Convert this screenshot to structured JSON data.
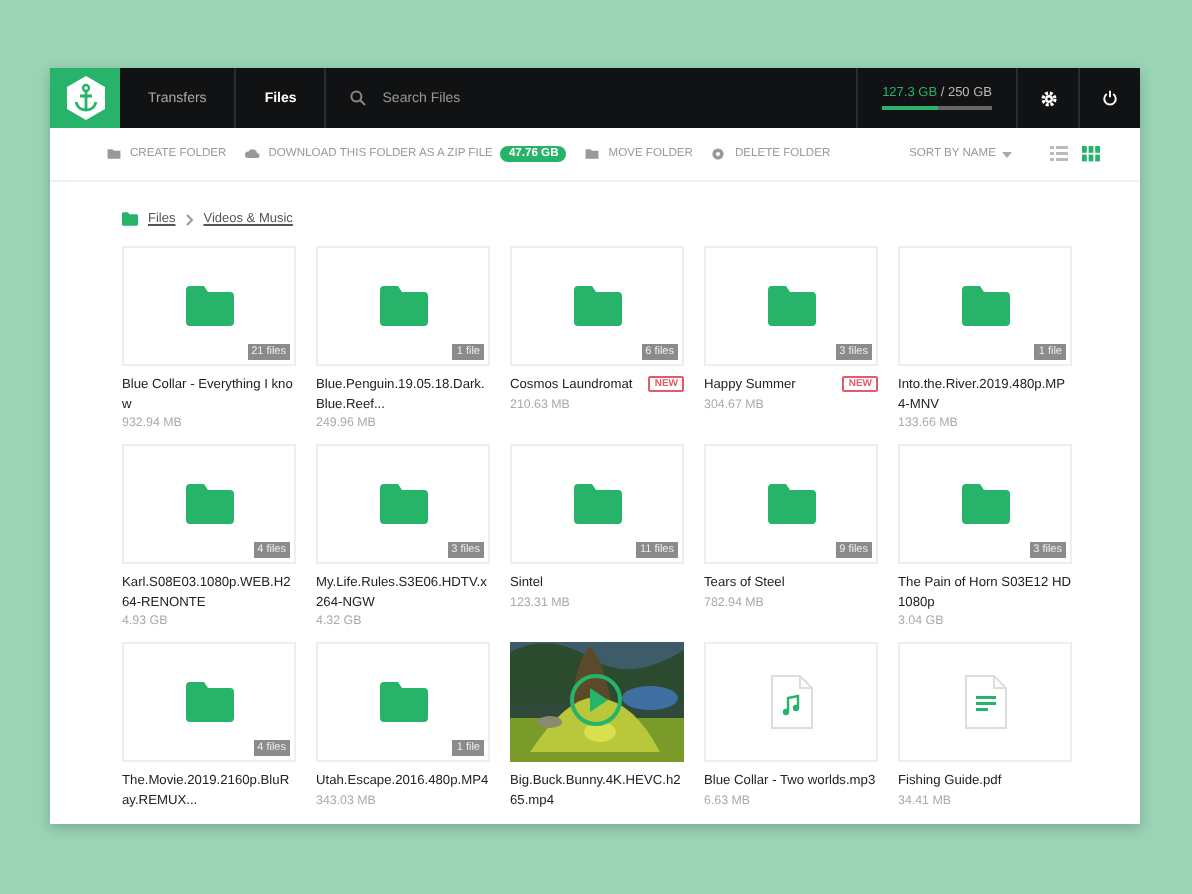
{
  "topbar": {
    "tabs": [
      {
        "label": "Transfers",
        "selected": false
      },
      {
        "label": "Files",
        "selected": true
      }
    ],
    "search": {
      "placeholder": "Search Files"
    },
    "storage": {
      "used": "127.3 GB",
      "total": " / 250 GB",
      "level": 0.51
    }
  },
  "toolbar": {
    "actions": [
      {
        "kind": "create",
        "label": "CREATE FOLDER"
      },
      {
        "kind": "download",
        "label": "DOWNLOAD THIS FOLDER AS A ZIP FILE",
        "badge": "47.76 GB"
      },
      {
        "kind": "move",
        "label": "MOVE FOLDER"
      },
      {
        "kind": "delete",
        "label": "DELETE FOLDER"
      }
    ],
    "sort": "SORT BY NAME",
    "views": [
      {
        "kind": "list",
        "selected": false
      },
      {
        "kind": "grid",
        "selected": true
      }
    ]
  },
  "breadcrumb": [
    "Files",
    "Videos & Music"
  ],
  "items": [
    {
      "kind": "folder",
      "name": "Blue Collar - Everything I know",
      "size": "932.94 MB",
      "count": "21 files"
    },
    {
      "kind": "folder",
      "name": "Blue.Penguin.19.05.18.Dark.Blue.Reef...",
      "size": "249.96 MB",
      "count": "1 file"
    },
    {
      "kind": "folder",
      "name": "Cosmos Laundromat",
      "size": "210.63 MB",
      "count": "6 files",
      "badge": "NEW"
    },
    {
      "kind": "folder",
      "name": "Happy Summer",
      "size": "304.67 MB",
      "count": "3 files",
      "badge": "NEW"
    },
    {
      "kind": "folder",
      "name": "Into.the.River.2019.480p.MP4-MNV",
      "size": "133.66 MB",
      "count": "1 file"
    },
    {
      "kind": "folder",
      "name": "Karl.S08E03.1080p.WEB.H264-RENONTE",
      "size": "4.93 GB",
      "count": "4 files"
    },
    {
      "kind": "folder",
      "name": "My.Life.Rules.S3E06.HDTV.x264-NGW",
      "size": "4.32 GB",
      "count": "3 files"
    },
    {
      "kind": "folder",
      "name": "Sintel",
      "size": "123.31 MB",
      "count": "11 files"
    },
    {
      "kind": "folder",
      "name": "Tears of Steel",
      "size": "782.94 MB",
      "count": "9 files"
    },
    {
      "kind": "folder",
      "name": "The Pain of Horn S03E12 HD 1080p",
      "size": "3.04 GB",
      "count": "3 files"
    },
    {
      "kind": "folder",
      "name": "The.Movie.2019.2160p.BluRay.REMUX...",
      "count": "4 files"
    },
    {
      "kind": "folder",
      "name": "Utah.Escape.2016.480p.MP4",
      "size": "343.03 MB",
      "count": "1 file"
    },
    {
      "kind": "video",
      "name": "Big.Buck.Bunny.4K.HEVC.h265.mp4"
    },
    {
      "kind": "audio",
      "name": "Blue Collar - Two worlds.mp3",
      "size": "6.63 MB"
    },
    {
      "kind": "document",
      "name": "Fishing Guide.pdf",
      "size": "34.41 MB"
    }
  ]
}
